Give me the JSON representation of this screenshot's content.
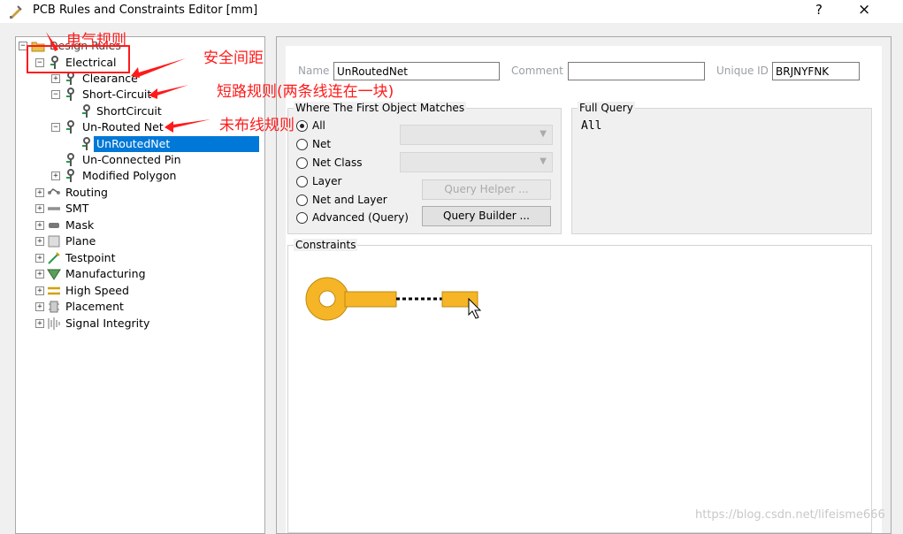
{
  "window": {
    "title": "PCB Rules and Constraints Editor [mm]",
    "help_label": "?",
    "close_label": "×"
  },
  "tree": {
    "root": "Design Rules",
    "items": [
      {
        "label": "Electrical"
      },
      {
        "label": "Clearance"
      },
      {
        "label": "Short-Circuit"
      },
      {
        "label": "ShortCircuit"
      },
      {
        "label": "Un-Routed Net"
      },
      {
        "label": "UnRoutedNet"
      },
      {
        "label": "Un-Connected Pin"
      },
      {
        "label": "Modified Polygon"
      },
      {
        "label": "Routing"
      },
      {
        "label": "SMT"
      },
      {
        "label": "Mask"
      },
      {
        "label": "Plane"
      },
      {
        "label": "Testpoint"
      },
      {
        "label": "Manufacturing"
      },
      {
        "label": "High Speed"
      },
      {
        "label": "Placement"
      },
      {
        "label": "Signal Integrity"
      }
    ]
  },
  "rule": {
    "name_label": "Name",
    "name_value": "UnRoutedNet",
    "comment_label": "Comment",
    "comment_value": "",
    "uid_label": "Unique ID",
    "uid_value": "BRJNYFNK"
  },
  "match": {
    "title": "Where The First Object Matches",
    "options": [
      "All",
      "Net",
      "Net Class",
      "Layer",
      "Net and Layer",
      "Advanced (Query)"
    ],
    "selected": "All",
    "query_helper": "Query Helper ...",
    "query_builder": "Query Builder ..."
  },
  "full_query": {
    "title": "Full Query",
    "text": "All"
  },
  "constraints": {
    "title": "Constraints"
  },
  "annotations": {
    "electrical": "电气规则",
    "clearance": "安全间距",
    "short_circuit": "短路规则(两条线连在一块)",
    "unrouted": "未布线规则"
  },
  "watermark": "https://blog.csdn.net/lifeisme666",
  "colors": {
    "selection": "#0078d7",
    "annotation": "#ff1a1a",
    "pad": "#f5b526"
  }
}
